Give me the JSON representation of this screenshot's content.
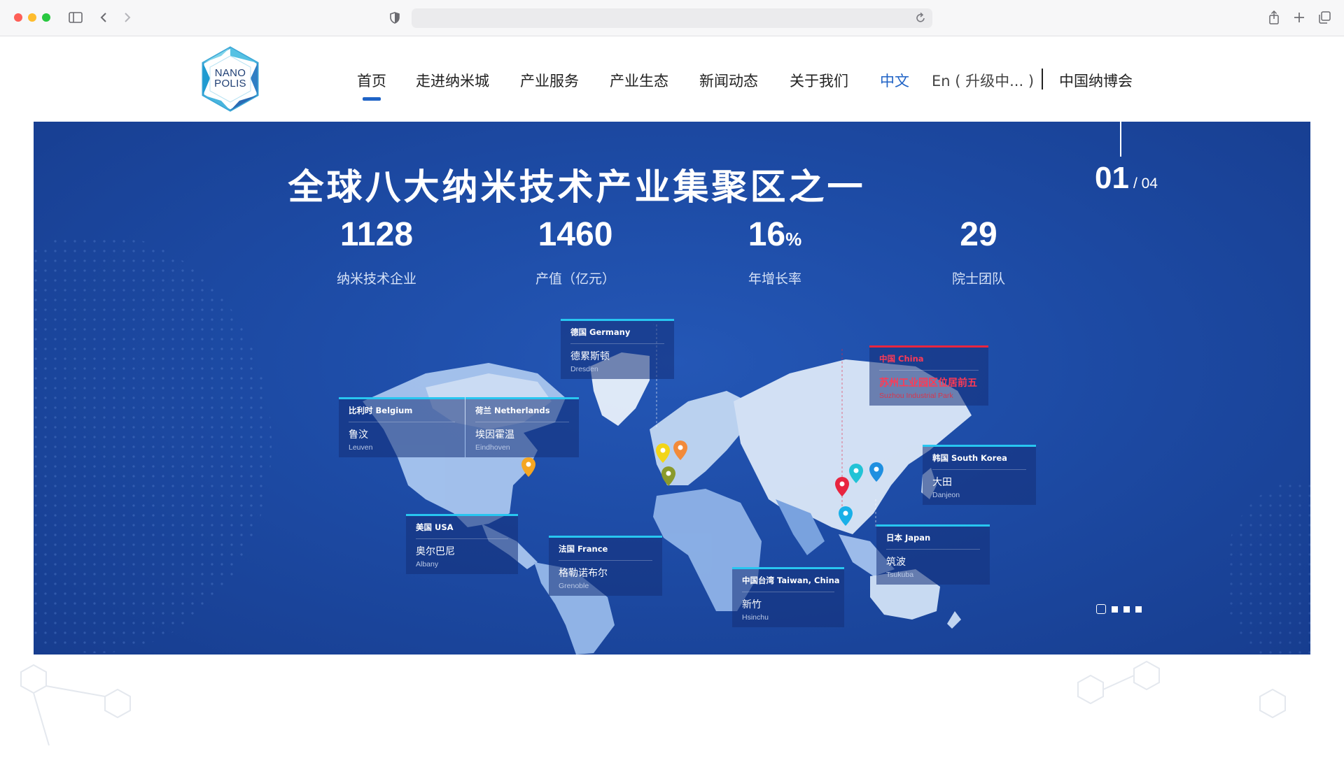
{
  "browser": {
    "icons": [
      "sidebar-icon",
      "back-icon",
      "forward-icon",
      "shield-icon",
      "reload-icon",
      "share-icon",
      "new-tab-icon",
      "tabs-overview-icon"
    ]
  },
  "header": {
    "logo": {
      "line1": "NANO",
      "line2": "POLIS"
    },
    "nav": [
      {
        "label": "首页",
        "active": true
      },
      {
        "label": "走进纳米城"
      },
      {
        "label": "产业服务"
      },
      {
        "label": "产业生态"
      },
      {
        "label": "新闻动态"
      },
      {
        "label": "关于我们"
      }
    ],
    "lang_cn": "中文",
    "lang_en": "En ( 升级中... )",
    "expo": "中国纳博会",
    "colors": {
      "accent": "#1f63c6"
    }
  },
  "hero": {
    "title": "全球八大纳米技术产业集聚区之一",
    "slide_current": "01",
    "slide_total": "/ 04",
    "stats": [
      {
        "value": "1128",
        "unit": "",
        "label": "纳米技术企业"
      },
      {
        "value": "1460",
        "unit": "",
        "label": "产值（亿元）"
      },
      {
        "value": "16",
        "unit": "%",
        "label": "年增长率"
      },
      {
        "value": "29",
        "unit": "",
        "label": "院士团队"
      }
    ],
    "cards": [
      {
        "country": "德国 Germany",
        "city": "德累斯顿",
        "en": "Dresden"
      },
      {
        "country": "中国 China",
        "city": "苏州工业园区位居前五",
        "en": "Suzhou Industrial Park",
        "highlight": true
      },
      {
        "country": "比利时 Belgium",
        "city": "鲁汶",
        "en": "Leuven"
      },
      {
        "country": "荷兰 Netherlands",
        "city": "埃因霍温",
        "en": "Eindhoven"
      },
      {
        "country": "韩国 South Korea",
        "city": "大田",
        "en": "Danjeon"
      },
      {
        "country": "美国 USA",
        "city": "奥尔巴尼",
        "en": "Albany"
      },
      {
        "country": "法国 France",
        "city": "格勒诺布尔",
        "en": "Grenoble"
      },
      {
        "country": "日本 Japan",
        "city": "筑波",
        "en": "Tsukuba"
      },
      {
        "country": "中国台湾 Taiwan, China",
        "city": "新竹",
        "en": "Hsinchu"
      }
    ],
    "pager": {
      "count": 4,
      "active": 0
    },
    "colors": {
      "background": "#1d4ba5",
      "card_border": "#28c6f0",
      "highlight": "#e8253f"
    }
  }
}
